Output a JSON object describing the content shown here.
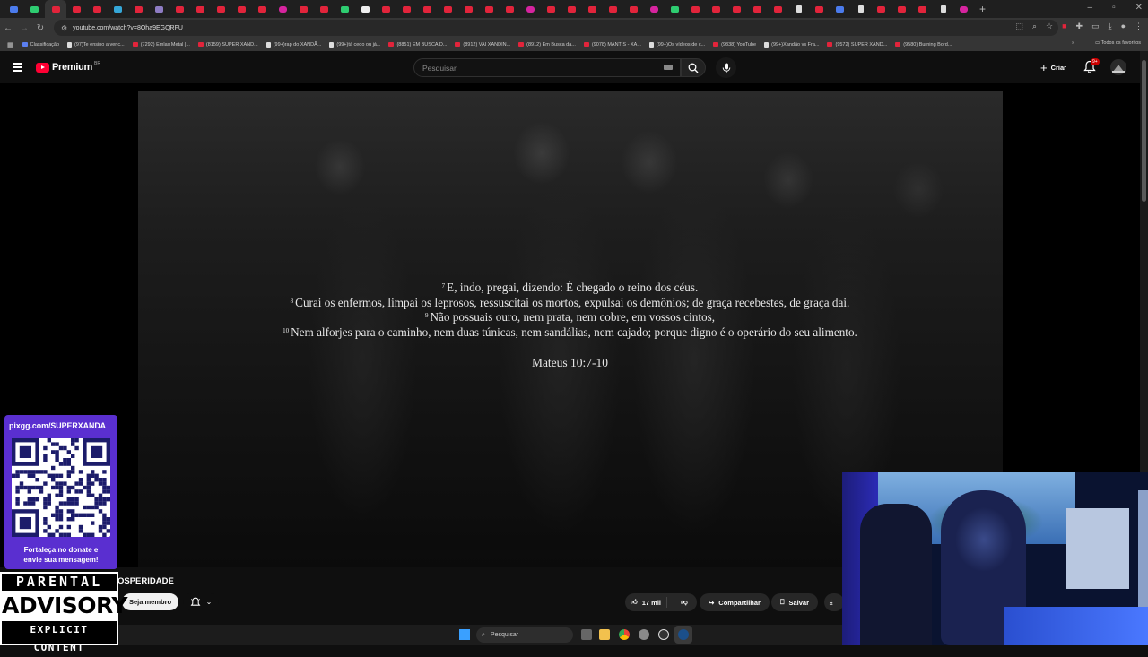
{
  "browser": {
    "url": "youtube.com/watch?v=8Oha9EGQRFU",
    "bookmarks": [
      {
        "label": "Classificação",
        "icon": "classificacao-icon"
      },
      {
        "label": "(97)Te ensino a venc...",
        "icon": "tiktok-icon"
      },
      {
        "label": "(7292) Emlax Metal |...",
        "icon": "youtube-icon"
      },
      {
        "label": "(8159) SUPER XAND...",
        "icon": "youtube-icon"
      },
      {
        "label": "(99+)rap do XANDÃ...",
        "icon": "tiktok-icon"
      },
      {
        "label": "(99+)tá cedo ou já...",
        "icon": "tiktok-icon"
      },
      {
        "label": "(8851) EM BUSCA D...",
        "icon": "youtube-icon"
      },
      {
        "label": "(8912) VAI XANDIN...",
        "icon": "youtube-icon"
      },
      {
        "label": "(8912) Em Busca da...",
        "icon": "youtube-icon"
      },
      {
        "label": "(9078) MANTIS - XA...",
        "icon": "youtube-icon"
      },
      {
        "label": "(99+)Os vídeos de c...",
        "icon": "tiktok-icon"
      },
      {
        "label": "(9338) YouTube",
        "icon": "youtube-icon"
      },
      {
        "label": "(99+)Xandão vs Fra...",
        "icon": "tiktok-icon"
      },
      {
        "label": "(9572) SUPER XAND...",
        "icon": "youtube-icon"
      },
      {
        "label": "(9580) Burning Bord...",
        "icon": "youtube-icon"
      }
    ],
    "all_bookmarks": "Todos os favoritos"
  },
  "youtube": {
    "brand": "Premium",
    "country_code": "BR",
    "search_placeholder": "Pesquisar",
    "create_label": "Criar",
    "notification_count": "9+"
  },
  "video": {
    "verses": [
      {
        "num": "7",
        "text": "E, indo, pregai, dizendo: É chegado o reino dos céus."
      },
      {
        "num": "8",
        "text": "Curai os enfermos, limpai os leprosos, ressuscitai os mortos, expulsai os demônios; de graça recebestes, de graça dai."
      },
      {
        "num": "9",
        "text": "Não possuais ouro, nem prata, nem cobre, em vossos cintos,"
      },
      {
        "num": "10",
        "text": "Nem alforjes para o caminho, nem duas túnicas, nem sandálias, nem cajado; porque digno é o operário do seu alimento."
      }
    ],
    "reference": "Mateus 10:7-10",
    "title_partial": "OSPERIDADE"
  },
  "actions": {
    "member_label": "Seja membro",
    "likes": "17 mil",
    "share_label": "Compartilhar",
    "save_label": "Salvar"
  },
  "overlay": {
    "pix_url": "pixgg.com/SUPERXANDA",
    "message_line1": "Fortaleça no donate e",
    "message_line2": "envie sua mensagem!",
    "advisory_line1": "PARENTAL",
    "advisory_line2": "ADVISORY",
    "advisory_line3": "EXPLICIT CONTENT"
  },
  "taskbar": {
    "search_label": "Pesquisar"
  },
  "colors": {
    "youtube_red": "#ff0033",
    "pix_purple": "#5a2fd0"
  }
}
